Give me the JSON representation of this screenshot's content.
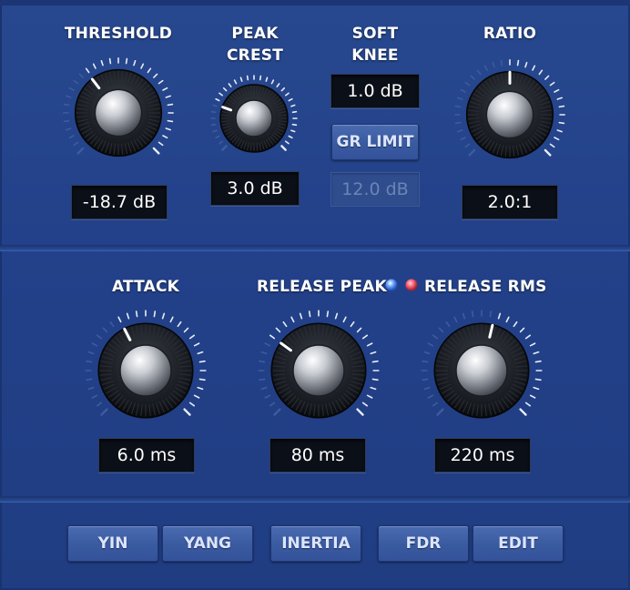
{
  "colors": {
    "panel": "#23418a",
    "display_bg": "#0b0f17",
    "button": "#3a5aa0",
    "led_blue": "#6fa8ff",
    "led_red": "#ff6b7a"
  },
  "top": {
    "threshold": {
      "label": "THRESHOLD",
      "value": "-18.7 dB"
    },
    "peak_crest": {
      "label_line1": "PEAK",
      "label_line2": "CREST",
      "value": "3.0 dB"
    },
    "soft_knee": {
      "label_line1": "SOFT",
      "label_line2": "KNEE",
      "value": "1.0 dB"
    },
    "gr_limit": {
      "label": "GR LIMIT",
      "value": "12.0 dB"
    },
    "ratio": {
      "label": "RATIO",
      "value": "2.0:1"
    }
  },
  "middle": {
    "attack": {
      "label": "ATTACK",
      "value": "6.0 ms"
    },
    "release_peak": {
      "label": "RELEASE PEAK",
      "value": "80 ms"
    },
    "release_rms": {
      "label": "RELEASE RMS",
      "value": "220 ms"
    }
  },
  "bottom": {
    "buttons": [
      "YIN",
      "YANG",
      "INERTIA",
      "FDR",
      "EDIT"
    ]
  },
  "knob_levels": {
    "threshold": 0.36,
    "peak_crest": 0.24,
    "ratio": 0.5,
    "attack": 0.4,
    "release_peak": 0.3,
    "release_rms": 0.55
  }
}
